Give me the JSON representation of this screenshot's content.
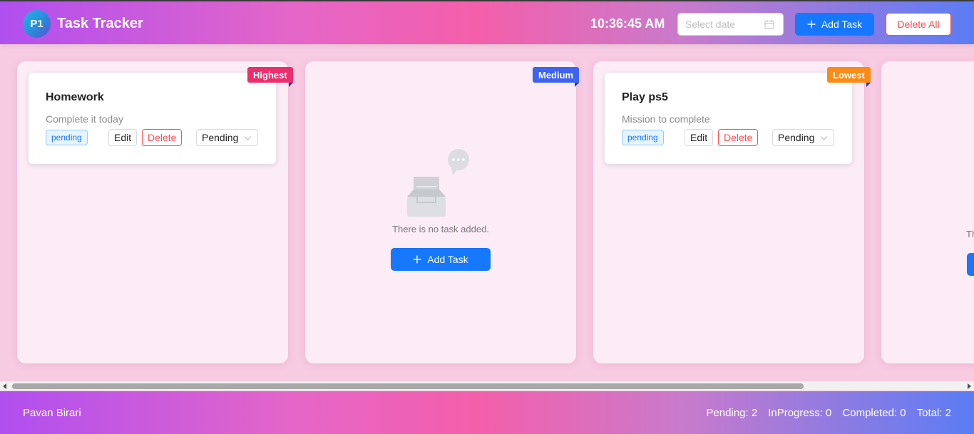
{
  "header": {
    "logo_text": "P1",
    "title": "Task Tracker",
    "clock": "10:36:45 AM",
    "date_placeholder": "Select date",
    "add_task_label": "Add Task",
    "delete_all_label": "Delete All"
  },
  "columns": [
    {
      "priority": "Highest",
      "priority_color": "#eb2f6e",
      "task": {
        "title": "Homework",
        "description": "Complete it today",
        "status_tag": "pending",
        "edit_label": "Edit",
        "delete_label": "Delete",
        "status_value": "Pending"
      }
    },
    {
      "priority": "Medium",
      "priority_color": "#3d63f0",
      "empty_text": "There is no task added.",
      "add_task_label": "Add Task"
    },
    {
      "priority": "Lowest",
      "priority_color": "#fa8c16",
      "task": {
        "title": "Play ps5",
        "description": "Mission to complete",
        "status_tag": "pending",
        "edit_label": "Edit",
        "delete_label": "Delete",
        "status_value": "Pending"
      }
    },
    {
      "empty_text": "Th"
    }
  ],
  "footer": {
    "author": "Pavan Birari",
    "stats": {
      "pending": "Pending: 2",
      "inprogress": "InProgress: 0",
      "completed": "Completed: 0",
      "total": "Total: 2"
    }
  },
  "icons": {
    "calendar": "calendar-icon",
    "plus": "plus-icon",
    "chevron": "chevron-down-icon",
    "empty_box": "empty-inbox-icon"
  },
  "colors": {
    "primary": "#1677ff",
    "danger": "#ff4d4f",
    "column_bg": "#fcecf6",
    "page_bg": "#f7cbe2"
  }
}
